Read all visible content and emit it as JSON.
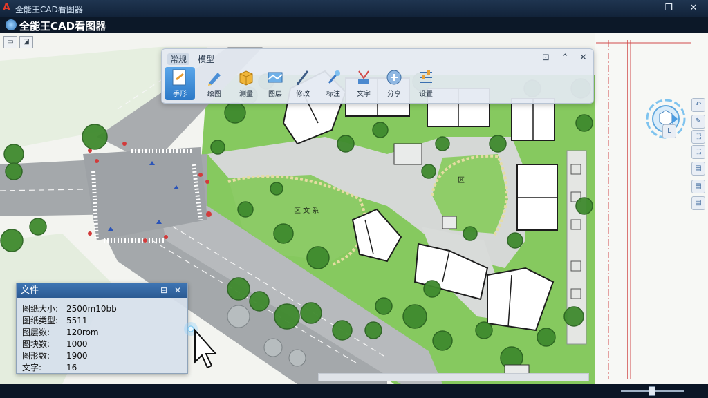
{
  "window": {
    "title": "全能王CAD看图器",
    "controls": {
      "minimize": "—",
      "maximize": "❐",
      "close": "✕"
    }
  },
  "app": {
    "brand": "全能王CAD看图器"
  },
  "ribbon": {
    "tabs": [
      {
        "label": "常规",
        "active": true
      },
      {
        "label": "模型",
        "active": false
      }
    ],
    "controls": {
      "pin": "⊡",
      "collapse": "⌃",
      "close": "✕"
    },
    "tools": [
      {
        "label": "手形",
        "icon": "hand-tool-icon",
        "active": true
      },
      {
        "label": "绘图",
        "icon": "pen-icon",
        "active": false
      },
      {
        "label": "测量",
        "icon": "measure-box-icon",
        "active": false
      },
      {
        "label": "图层",
        "icon": "layer-icon",
        "active": false
      },
      {
        "label": "修改",
        "icon": "pencil-icon",
        "active": false
      },
      {
        "label": "标注",
        "icon": "annotate-icon",
        "active": false
      },
      {
        "label": "文字",
        "icon": "text-tool-icon",
        "active": false
      },
      {
        "label": "分享",
        "icon": "share-icon",
        "active": false
      },
      {
        "label": "设置",
        "icon": "settings-icon",
        "active": false
      }
    ]
  },
  "info_panel": {
    "title": "文件",
    "rows": [
      {
        "key": "图纸大小:",
        "value": "2500m10bb"
      },
      {
        "key": "图纸类型:",
        "value": "5511"
      },
      {
        "key": "图层数:",
        "value": "120rom"
      },
      {
        "key": "图块数:",
        "value": "1000"
      },
      {
        "key": "图形数:",
        "value": "1900"
      },
      {
        "key": "文字:",
        "value": "16"
      }
    ]
  },
  "map_labels": {
    "label_a": "区 文 系",
    "label_b": "区"
  },
  "colors": {
    "accent": "#2d79c7",
    "grass": "#7cc356",
    "road": "#9aa0a6",
    "tree": "#3f8a2e",
    "building": "#ffffff"
  }
}
